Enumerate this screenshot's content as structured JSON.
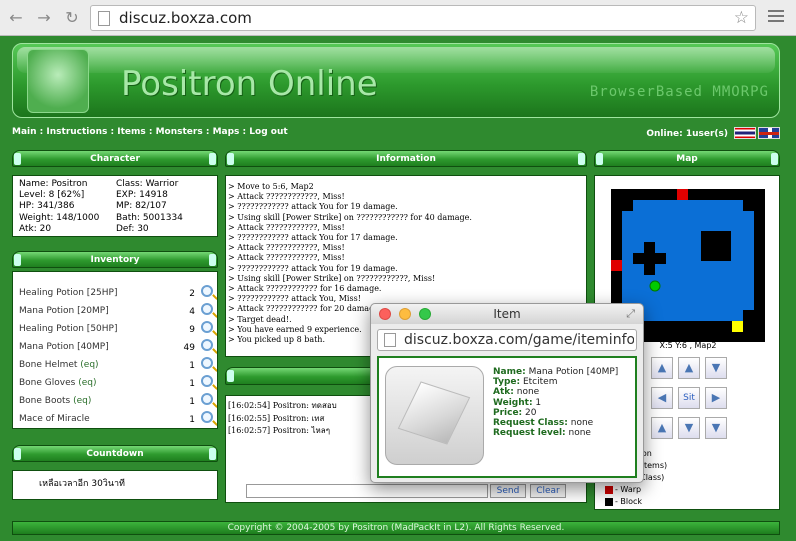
{
  "browser": {
    "url": "discuz.boxza.com",
    "back_icon": "back-arrow-icon",
    "forward_icon": "forward-arrow-icon",
    "reload_icon": "reload-icon"
  },
  "banner": {
    "title": "Positron Online",
    "subtitle": "BrowserBased MMORPG"
  },
  "nav": {
    "items": [
      "Main",
      "Instructions",
      "Items",
      "Monsters",
      "Maps",
      "Log out"
    ],
    "online_text": "Online: 1user(s)"
  },
  "character": {
    "title": "Character",
    "name": "Name: Positron",
    "class": "Class: Warrior",
    "level": "Level: 8 [62%]",
    "exp": "EXP: 14918",
    "hp": "HP: 341/386",
    "mp": "MP: 82/107",
    "weight": "Weight: 148/1000",
    "bath": "Bath: 5001334",
    "atk": "Atk: 20",
    "def": "Def: 30"
  },
  "inventory": {
    "title": "Inventory",
    "items": [
      {
        "name": "Healing Potion [25HP]",
        "eq": "",
        "qty": "2"
      },
      {
        "name": "Mana Potion [20MP]",
        "eq": "",
        "qty": "4"
      },
      {
        "name": "Healing Potion [50HP]",
        "eq": "",
        "qty": "9"
      },
      {
        "name": "Mana Potion [40MP]",
        "eq": "",
        "qty": "49"
      },
      {
        "name": "Bone Helmet",
        "eq": "(eq)",
        "qty": "1"
      },
      {
        "name": "Bone Gloves",
        "eq": "(eq)",
        "qty": "1"
      },
      {
        "name": "Bone Boots",
        "eq": "(eq)",
        "qty": "1"
      },
      {
        "name": "Mace of Miracle",
        "eq": "",
        "qty": "1"
      }
    ]
  },
  "countdown": {
    "title": "Countdown",
    "text": "เหลือเวลาอีก 30วินาที"
  },
  "information": {
    "title": "Information",
    "lines": [
      "> Move to 5:6, Map2",
      "> Attack ????????????, Miss!",
      "> ???????????? attack You for 19 damage.",
      "> Using skill [Power Strike] on ???????????? for 40 damage.",
      "> Attack ????????????, Miss!",
      "> ???????????? attack You for 17 damage.",
      "> Attack ????????????, Miss!",
      "> Attack ????????????, Miss!",
      "> ???????????? attack You for 19 damage.",
      "> Using skill [Power Strike] on ????????????, Miss!",
      "> Attack ???????????? for 16 damage.",
      "> ???????????? attack You, Miss!",
      "> Attack ???????????? for 20 damage.",
      "> Target dead!.",
      "> You have earned 9 experience.",
      "> You picked up 8 bath."
    ]
  },
  "chat": {
    "lines": [
      "[16:02:54] Positron: ทดสอบ",
      "[16:02:55] Positron: เทส",
      "[16:02:57] Positron: ไหลๆ"
    ],
    "send_label": "Send",
    "clear_label": "Clear"
  },
  "map": {
    "title": "Map",
    "coord": "X:5 Y:6 , Map2",
    "sit_label": "Sit",
    "legend": [
      {
        "label": "ent Position",
        "color": "#00cc00"
      },
      {
        "label": "(buy/sell items)",
        "color": "#ffff00"
      },
      {
        "label": "(change Class)",
        "color": "#ff0000"
      },
      {
        "label": "- Warp",
        "color": "#cc0000"
      },
      {
        "label": "- Block",
        "color": "#000000"
      }
    ],
    "colors": {
      "water": "#0b6fd6",
      "block": "#000000",
      "warp": "#e00000",
      "shop": "#ffff00",
      "player": "#00cc00"
    }
  },
  "footer": {
    "text": "Copyright © 2004-2005 by Positron (MadPackIt in L2). All Rights Reserved."
  },
  "popup": {
    "title": "Item",
    "url": "discuz.boxza.com/game/iteminfo....",
    "image_icon": "gem-icon",
    "fields": [
      {
        "k": "Name:",
        "v": "Mana Potion [40MP]"
      },
      {
        "k": "Type:",
        "v": "Etcitem"
      },
      {
        "k": "Atk:",
        "v": "none"
      },
      {
        "k": "Weight:",
        "v": "1"
      },
      {
        "k": "Price:",
        "v": "20"
      },
      {
        "k": "Request Class:",
        "v": "none"
      },
      {
        "k": "Request level:",
        "v": "none"
      }
    ]
  }
}
